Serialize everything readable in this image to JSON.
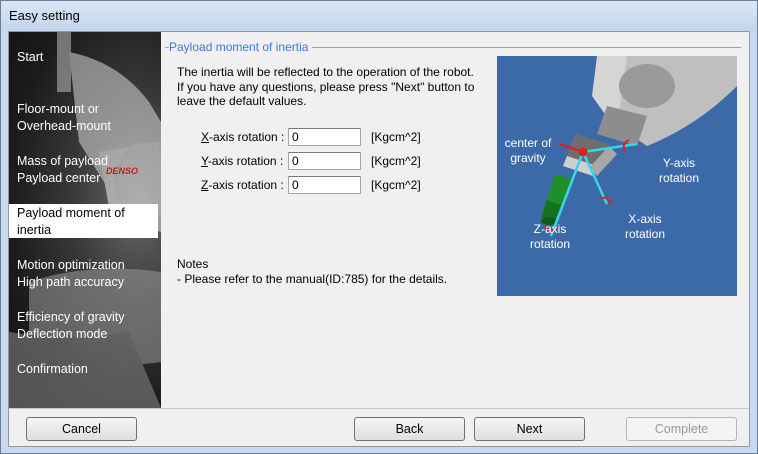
{
  "window": {
    "title": "Easy setting"
  },
  "sidebar": {
    "items": [
      {
        "lines": [
          "Start",
          ""
        ],
        "active": false
      },
      {
        "lines": [
          "Floor-mount or",
          "Overhead-mount"
        ],
        "active": false
      },
      {
        "lines": [
          "Mass of payload",
          "Payload center"
        ],
        "active": false
      },
      {
        "lines": [
          "Payload moment of",
          "inertia"
        ],
        "active": true
      },
      {
        "lines": [
          "Motion optimization",
          "High path accuracy"
        ],
        "active": false
      },
      {
        "lines": [
          "Efficiency of gravity",
          "Deflection mode"
        ],
        "active": false
      },
      {
        "lines": [
          "Confirmation",
          ""
        ],
        "active": false
      }
    ],
    "robot_logo_text": "DENSO"
  },
  "section": {
    "title": "Payload moment of inertia"
  },
  "description": {
    "lines": [
      "The inertia will be reflected to the operation of the robot.",
      "If you have any questions, please press \"Next\" button to",
      "leave the default values."
    ]
  },
  "fields": [
    {
      "axis_letter": "X",
      "label_rest": "-axis rotation :",
      "value": "0",
      "unit": "[Kgcm^2]"
    },
    {
      "axis_letter": "Y",
      "label_rest": "-axis rotation :",
      "value": "0",
      "unit": "[Kgcm^2]"
    },
    {
      "axis_letter": "Z",
      "label_rest": "-axis rotation :",
      "value": "0",
      "unit": "[Kgcm^2]"
    }
  ],
  "notes": {
    "heading": "Notes",
    "text": "- Please refer to the manual(ID:785) for the details."
  },
  "diagram": {
    "center_label": [
      "center of",
      "gravity"
    ],
    "y_label": [
      "Y-axis",
      "rotation"
    ],
    "x_label": [
      "X-axis",
      "rotation"
    ],
    "z_label": [
      "Z-axis",
      "rotation"
    ],
    "bg_color": "#3c6aa8",
    "axis_color": "#35d8e8",
    "accent_color": "#e02020"
  },
  "buttons": {
    "cancel": "Cancel",
    "back": "Back",
    "next": "Next",
    "complete": "Complete"
  }
}
